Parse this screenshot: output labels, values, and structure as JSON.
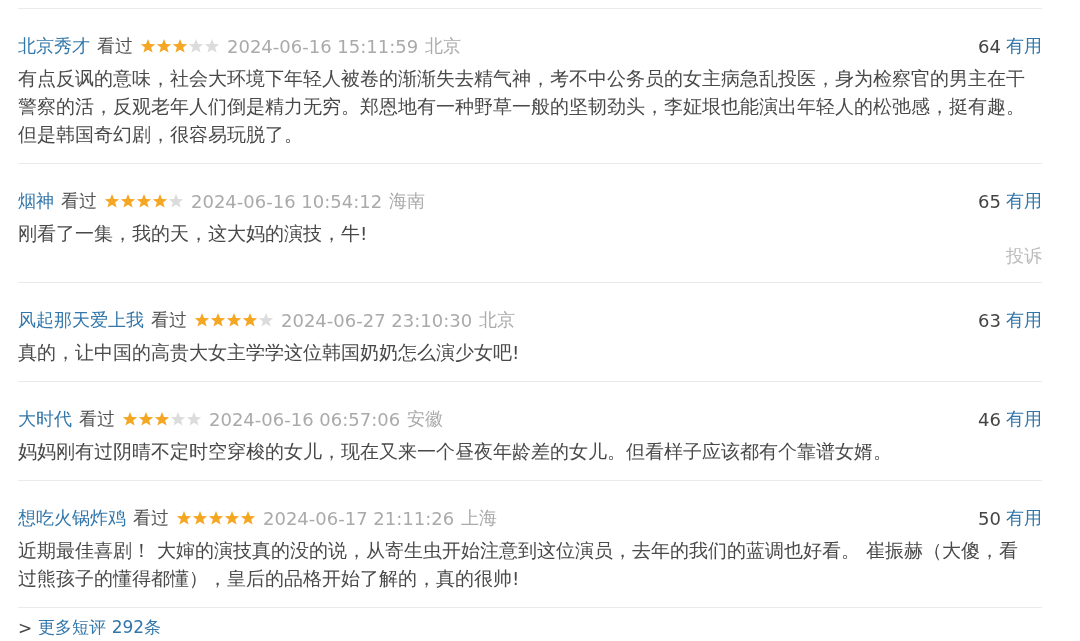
{
  "comments": [
    {
      "user": "北京秀才",
      "status": "看过",
      "stars": 3,
      "time": "2024-06-16 15:11:59",
      "location": "北京",
      "votes": "64",
      "vote_label": "有用",
      "text": "有点反讽的意味，社会大环境下年轻人被卷的渐渐失去精气神，考不中公务员的女主病急乱投医，身为检察官的男主在干警察的活，反观老年人们倒是精力无穷。郑恩地有一种野草一般的坚韧劲头，李姃垠也能演出年轻人的松弛感，挺有趣。但是韩国奇幻剧，很容易玩脱了。"
    },
    {
      "user": "烟神",
      "status": "看过",
      "stars": 4,
      "time": "2024-06-16 10:54:12",
      "location": "海南",
      "votes": "65",
      "vote_label": "有用",
      "text": "刚看了一集，我的天，这大妈的演技，牛!",
      "report": "投诉"
    },
    {
      "user": "风起那天爱上我",
      "status": "看过",
      "stars": 4,
      "time": "2024-06-27 23:10:30",
      "location": "北京",
      "votes": "63",
      "vote_label": "有用",
      "text": "真的，让中国的高贵大女主学学这位韩国奶奶怎么演少女吧!"
    },
    {
      "user": "大时代",
      "status": "看过",
      "stars": 3,
      "time": "2024-06-16 06:57:06",
      "location": "安徽",
      "votes": "46",
      "vote_label": "有用",
      "text": "妈妈刚有过阴晴不定时空穿梭的女儿，现在又来一个昼夜年龄差的女儿。但看样子应该都有个靠谱女婿。"
    },
    {
      "user": "想吃火锅炸鸡",
      "status": "看过",
      "stars": 5,
      "time": "2024-06-17 21:11:26",
      "location": "上海",
      "votes": "50",
      "vote_label": "有用",
      "text": "近期最佳喜剧！ 大婶的演技真的没的说，从寄生虫开始注意到这位演员，去年的我们的蓝调也好看。 崔振赫（大傻，看过熊孩子的懂得都懂），皇后的品格开始了解的，真的很帅!"
    }
  ],
  "more": {
    "prefix": ">",
    "label": "更多短评 292条"
  }
}
